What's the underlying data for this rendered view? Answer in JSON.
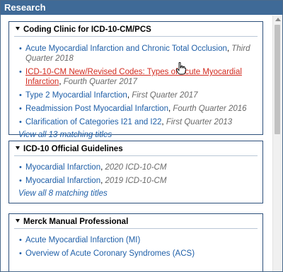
{
  "panel": {
    "title": "Research"
  },
  "sections": [
    {
      "title": "Coding Clinic for ICD-10-CM/PCS",
      "items": [
        {
          "title": "Acute Myocardial Infarction and Chronic Total Occlusion",
          "source": "Third Quarter 2018",
          "active": false
        },
        {
          "title": "ICD-10-CM New/Revised Codes: Types of Acute Myocardial Infarction",
          "source": "Fourth Quarter 2017",
          "active": true
        },
        {
          "title": "Type 2 Myocardial Infarction",
          "source": "First Quarter 2017",
          "active": false
        },
        {
          "title": "Readmission Post Myocardial Infarction",
          "source": "Fourth Quarter 2016",
          "active": false
        },
        {
          "title": "Clarification of Categories I21 and I22",
          "source": "First Quarter 2013",
          "active": false
        }
      ],
      "view_all": "View all 13 matching titles"
    },
    {
      "title": "ICD-10 Official Guidelines",
      "items": [
        {
          "title": "Myocardial Infarction",
          "source": "2020 ICD-10-CM"
        },
        {
          "title": "Myocardial Infarction",
          "source": "2019 ICD-10-CM"
        }
      ],
      "view_all": "View all 8 matching titles"
    },
    {
      "title": "Merck Manual Professional",
      "items": [
        {
          "title": "Acute Myocardial Infarction (MI)",
          "source": ""
        },
        {
          "title": "Overview of Acute Coronary Syndromes (ACS)",
          "source": ""
        }
      ]
    }
  ],
  "icons": {
    "collapse": "triangle-down-icon",
    "cursor": "hand-pointer-icon"
  },
  "colors": {
    "header_bg": "#3f6a97",
    "link": "#1f5fa8",
    "active_link": "#d22a1f",
    "section_border": "#2c4f7a"
  }
}
